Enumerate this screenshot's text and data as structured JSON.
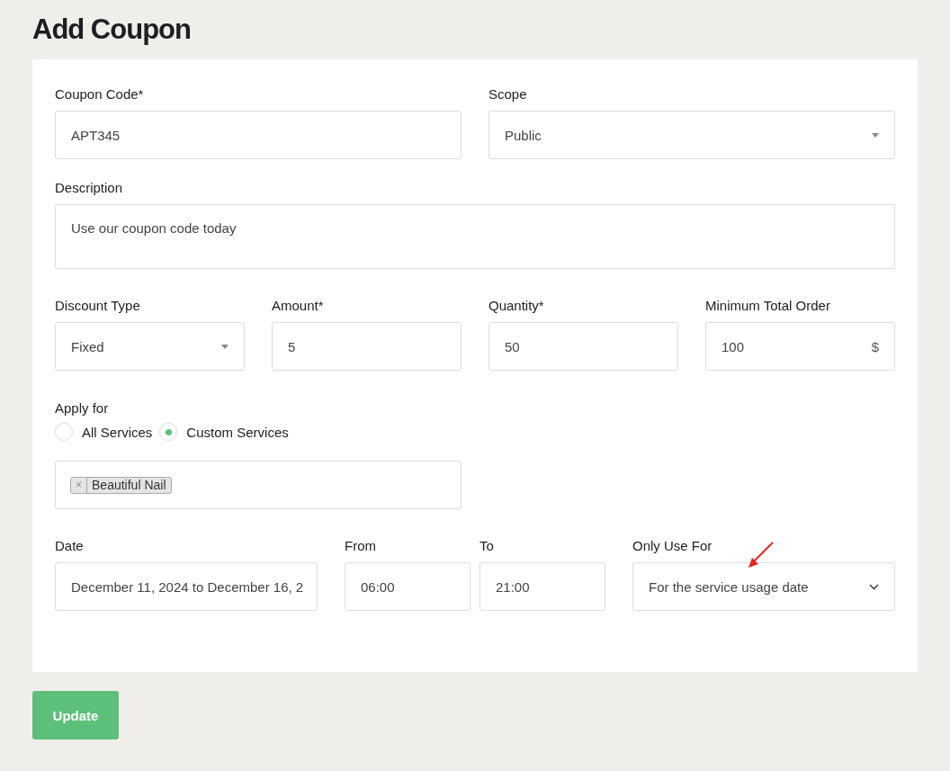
{
  "title": "Add Coupon",
  "coupon_code": {
    "label": "Coupon Code*",
    "value": "APT345"
  },
  "scope": {
    "label": "Scope",
    "value": "Public"
  },
  "description": {
    "label": "Description",
    "value": "Use our coupon code today"
  },
  "discount_type": {
    "label": "Discount Type",
    "value": "Fixed"
  },
  "amount": {
    "label": "Amount*",
    "value": "5"
  },
  "quantity": {
    "label": "Quantity*",
    "value": "50"
  },
  "minimum_total_order": {
    "label": "Minimum Total Order",
    "value": "100",
    "suffix": "$"
  },
  "apply_for": {
    "label": "Apply for",
    "options": [
      {
        "label": "All Services",
        "selected": false
      },
      {
        "label": "Custom Services",
        "selected": true
      }
    ],
    "tags": [
      {
        "label": "Beautiful Nail",
        "remove": "×"
      }
    ]
  },
  "date": {
    "label": "Date",
    "value": "December 11, 2024 to December 16, 2"
  },
  "from": {
    "label": "From",
    "value": "06:00"
  },
  "to": {
    "label": "To",
    "value": "21:00"
  },
  "only_use_for": {
    "label": "Only Use For",
    "value": "For the service usage date"
  },
  "submit": "Update"
}
